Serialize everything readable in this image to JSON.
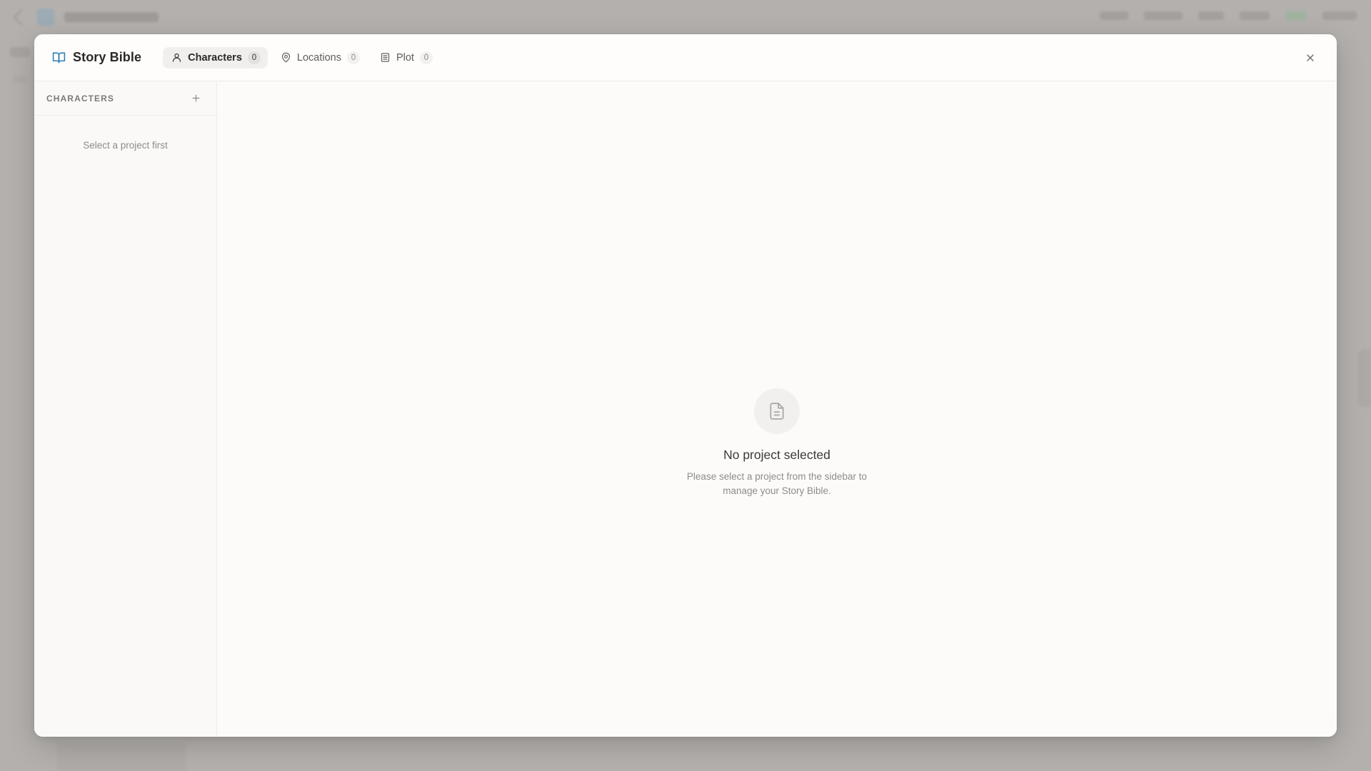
{
  "app": {
    "title": "Story Bible"
  },
  "tabs": [
    {
      "label": "Characters",
      "count": "0",
      "icon": "user-icon",
      "active": true
    },
    {
      "label": "Locations",
      "count": "0",
      "icon": "map-pin-icon",
      "active": false
    },
    {
      "label": "Plot",
      "count": "0",
      "icon": "list-icon",
      "active": false
    }
  ],
  "sidebar": {
    "title": "CHARACTERS",
    "empty_text": "Select a project first"
  },
  "main": {
    "empty_title": "No project selected",
    "empty_desc": "Please select a project from the sidebar to manage your Story Bible."
  },
  "colors": {
    "accent": "#2f7fb8",
    "overlay": "#b3b0ad",
    "modal_bg": "#fcfbfa"
  }
}
